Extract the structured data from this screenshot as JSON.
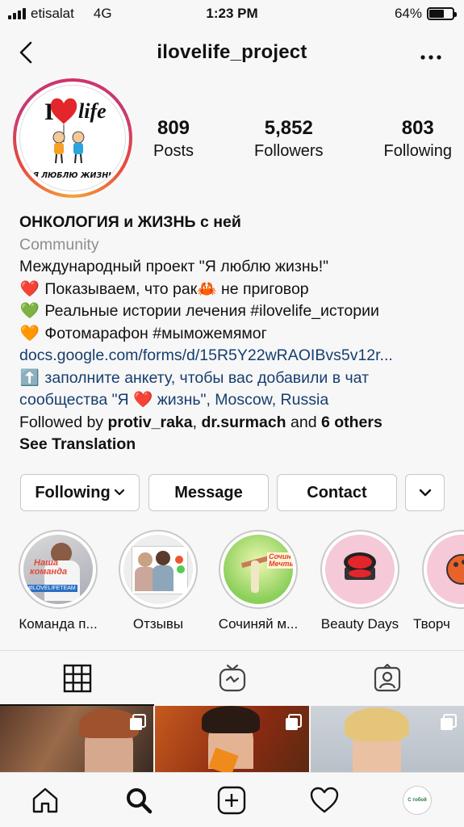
{
  "status_bar": {
    "carrier": "etisalat",
    "network": "4G",
    "time": "1:23 PM",
    "battery": "64%",
    "battery_level": 0.64
  },
  "header": {
    "username": "ilovelife_project",
    "back_icon": "chevron-left-icon",
    "more_icon": "more-horizontal-icon"
  },
  "avatar": {
    "logo_text_top": "I",
    "logo_text_life": "life",
    "logo_caption": "Я ЛЮБЛЮ ЖИЗНЬ"
  },
  "stats": [
    {
      "count": "809",
      "label": "Posts"
    },
    {
      "count": "5,852",
      "label": "Followers"
    },
    {
      "count": "803",
      "label": "Following"
    }
  ],
  "bio": {
    "name": "ОНКОЛОГИЯ и ЖИЗНЬ с ней",
    "category": "Community",
    "line1": "Международный проект \"Я люблю жизнь!\"",
    "line2_emoji": "❤️",
    "line2_a": " Показываем, что рак",
    "line2_crab": "🦀",
    "line2_b": " не приговор",
    "line3_emoji": "💚",
    "line3": " Реальные истории лечения #ilovelife_истории",
    "line4_emoji": "🧡",
    "line4": " Фотомарафон #мыможемямог",
    "link": "docs.google.com/forms/d/15R5Y22wRAOIBvs5v12r...",
    "line6_emoji": "⬆️",
    "line6": " заполните анкету, чтобы вас добавили в чат",
    "line7_a": "сообщества \"Я ",
    "line7_heart": "❤️",
    "line7_b": " жизнь\", Moscow, Russia",
    "followed_prefix": "Followed by ",
    "followed_user1": "protiv_raka",
    "followed_sep": ", ",
    "followed_user2": "dr.surmach",
    "followed_and": " and ",
    "followed_others": "6 others",
    "see_translation": "See Translation"
  },
  "actions": {
    "following": "Following",
    "message": "Message",
    "contact": "Contact"
  },
  "highlights": [
    {
      "label": "Команда п...",
      "overlay_text": "Наша команда",
      "badge": "#ILOVELIFETEAM"
    },
    {
      "label": "Отзывы"
    },
    {
      "label": "Сочиняй м...",
      "overlay_text": "Сочиняй Мечты!"
    },
    {
      "label": "Beauty Days"
    },
    {
      "label": "Творч"
    }
  ],
  "tabs": [
    "grid-icon",
    "igtv-icon",
    "tagged-icon"
  ],
  "bottom_nav": [
    "home-icon",
    "search-icon",
    "new-post-icon",
    "heart-icon",
    "profile-avatar"
  ],
  "bottom_nav_avatar_text": "С тобой"
}
